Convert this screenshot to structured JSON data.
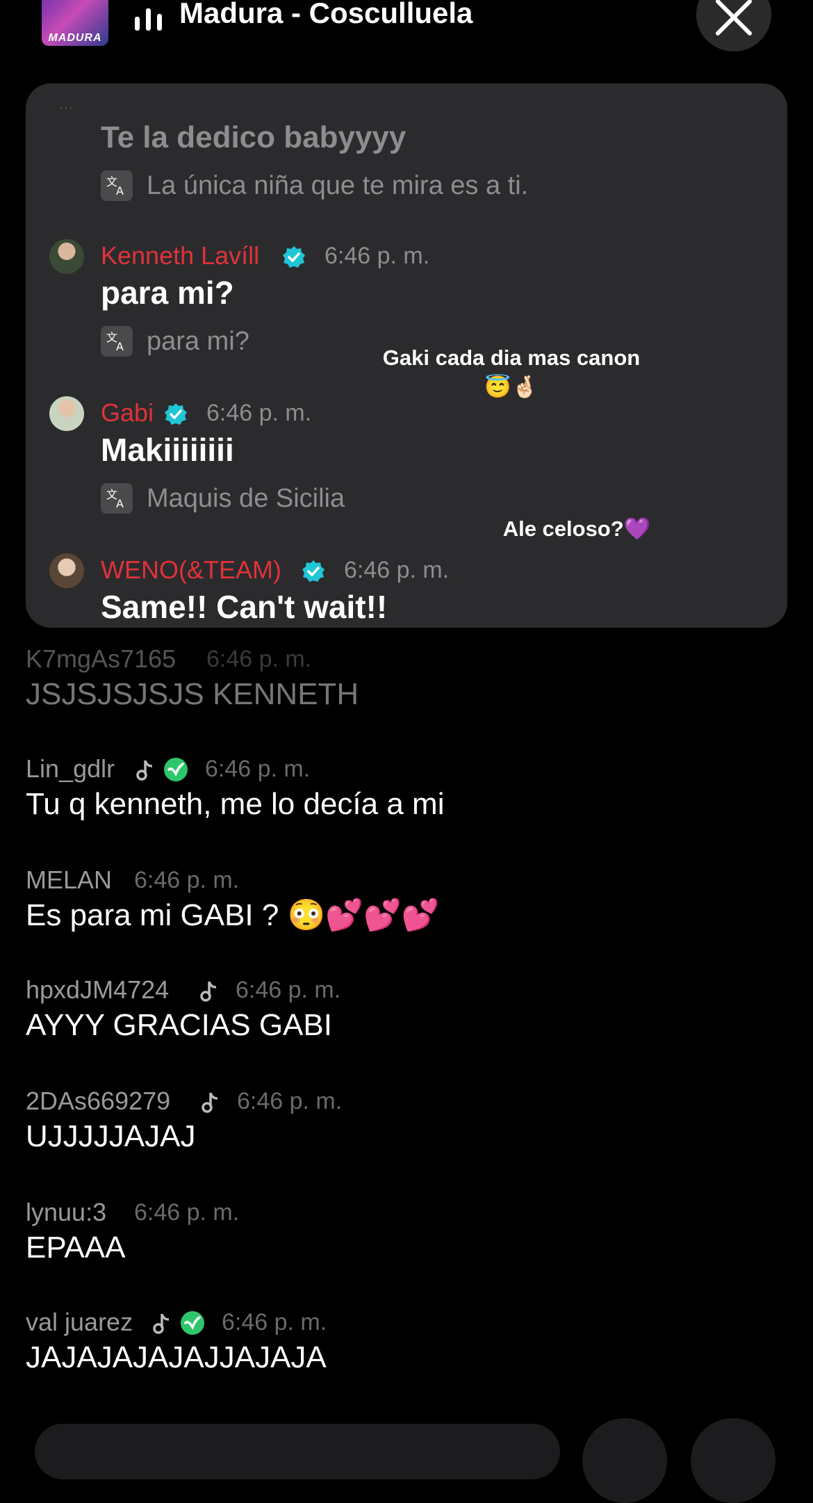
{
  "header": {
    "album_art_text": "MADURA",
    "song_title": "Madura - Cosculluela"
  },
  "pinned": {
    "top_message": {
      "text": "Te la dedico babyyyy",
      "translation": "La única niña que te mira es a ti."
    },
    "messages": [
      {
        "user": "Kenneth Lavíll",
        "time": "6:46 p. m.",
        "text": "para mi?",
        "translation": "para mi?"
      },
      {
        "user": "Gabi",
        "time": "6:46 p. m.",
        "text": "Makiiiiiiii",
        "translation": "Maquis de Sicilia"
      },
      {
        "user": "WENO(&TEAM)",
        "time": "6:46 p. m.",
        "text": "Same!! Can't wait!!"
      }
    ]
  },
  "floating_comments": [
    {
      "text": "Gaki cada dia mas canon",
      "emoji": "😇🤞🏻"
    },
    {
      "text": "Ale celoso?💜"
    }
  ],
  "chat": [
    {
      "user": "K7mgAs7165",
      "time": "6:46 p. m.",
      "text": "JSJSJSJSJS KENNETH"
    },
    {
      "user": "Lin_gdlr",
      "time": "6:46 p. m.",
      "text": "Tu q kenneth, me lo decía a mi"
    },
    {
      "user": "MELAN",
      "time": "6:46 p. m.",
      "text": "Es para mi GABI ? 😳💕💕💕"
    },
    {
      "user": "hpxdJM4724",
      "time": "6:46 p. m.",
      "text": "AYYY GRACIAS GABI"
    },
    {
      "user": "2DAs669279",
      "time": "6:46 p. m.",
      "text": "UJJJJJAJAJ"
    },
    {
      "user": "lynuu:3",
      "time": "6:46 p. m.",
      "text": "EPAAA"
    },
    {
      "user": "val juarez",
      "time": "6:46 p. m.",
      "text": "JAJAJAJAJAJJAJAJA"
    }
  ],
  "colors": {
    "background": "#000000",
    "panel": "#2b2b2d",
    "username_red": "#e0323a",
    "verified_teal": "#20c5d6",
    "check_green": "#2ec66a"
  },
  "icons": [
    "equalizer-icon",
    "close-icon",
    "translate-icon",
    "verified-icon",
    "music-note-icon",
    "green-check-icon"
  ]
}
